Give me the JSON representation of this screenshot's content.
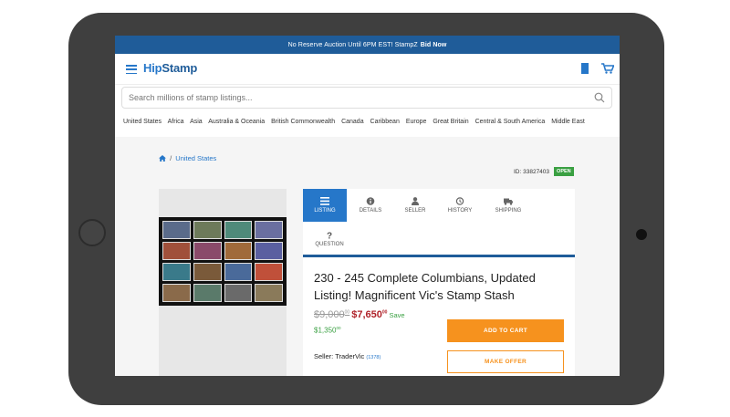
{
  "banner": {
    "text": "No Reserve Auction Until 6PM EST! StampZ",
    "link": "Bid Now"
  },
  "header": {
    "logo_a": "Hip",
    "logo_b": "Stamp"
  },
  "search": {
    "placeholder": "Search millions of stamp listings..."
  },
  "categories": [
    "United States",
    "Africa",
    "Asia",
    "Australia & Oceania",
    "British Commonwealth",
    "Canada",
    "Caribbean",
    "Europe",
    "Great Britain",
    "Central & South America",
    "Middle East"
  ],
  "breadcrumb": {
    "sep": "/",
    "current": "United States"
  },
  "listing": {
    "id_label": "ID: 33827403",
    "status": "OPEN",
    "tabs": [
      {
        "label": "LISTING"
      },
      {
        "label": "DETAILS"
      },
      {
        "label": "SELLER"
      },
      {
        "label": "HISTORY"
      },
      {
        "label": "SHIPPING"
      },
      {
        "label": "QUESTION"
      }
    ],
    "title": "230 - 245 Complete Columbians, Updated Listing! Magnificent Vic's Stamp Stash",
    "old_price": "$9,000",
    "old_cents": "00",
    "new_price": "$7,650",
    "new_cents": "00",
    "save_label": "Save",
    "savings": "$1,350",
    "savings_cents": "00",
    "seller_label": "Seller: TraderVic",
    "feedback": "(1378)",
    "add_to_cart": "ADD TO CART",
    "make_offer": "MAKE OFFER"
  },
  "colors": {
    "brand": "#1f5c99",
    "accent": "#2677c9",
    "orange": "#f6921e",
    "green": "#3aa042",
    "red": "#b0232a"
  }
}
